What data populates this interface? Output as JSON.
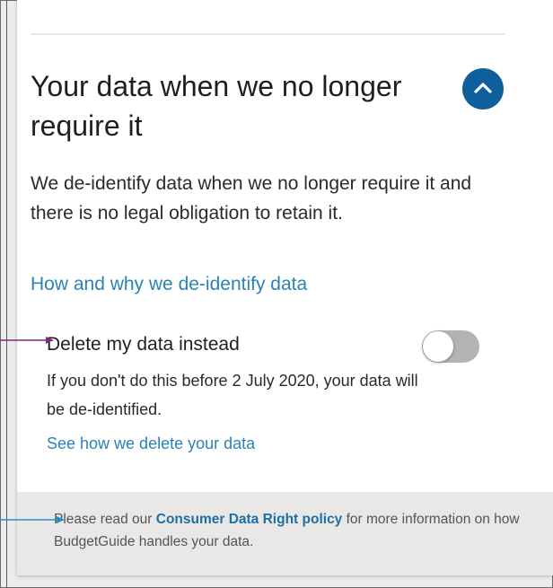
{
  "section": {
    "title": "Your data when we no longer require it",
    "collapse_icon": "chevron-up-icon",
    "description": "We de-identify data when we no longer require it and there is no legal obligation to retain it.",
    "link": "How and why we de-identify data"
  },
  "option": {
    "title": "Delete my data instead",
    "toggle_on": false,
    "description": "If you don't do this before 2 July 2020, your data will be de-identified.",
    "link": "See how we delete your data"
  },
  "footer": {
    "prefix": "Please read our ",
    "link": "Consumer Data Right policy",
    "suffix": " for more information on how BudgetGuide handles your data."
  },
  "colors": {
    "accent": "#0f5f9c",
    "link": "#2b83b4",
    "annotation_purple": "#7a2d7a",
    "annotation_blue": "#2b8fc7"
  }
}
